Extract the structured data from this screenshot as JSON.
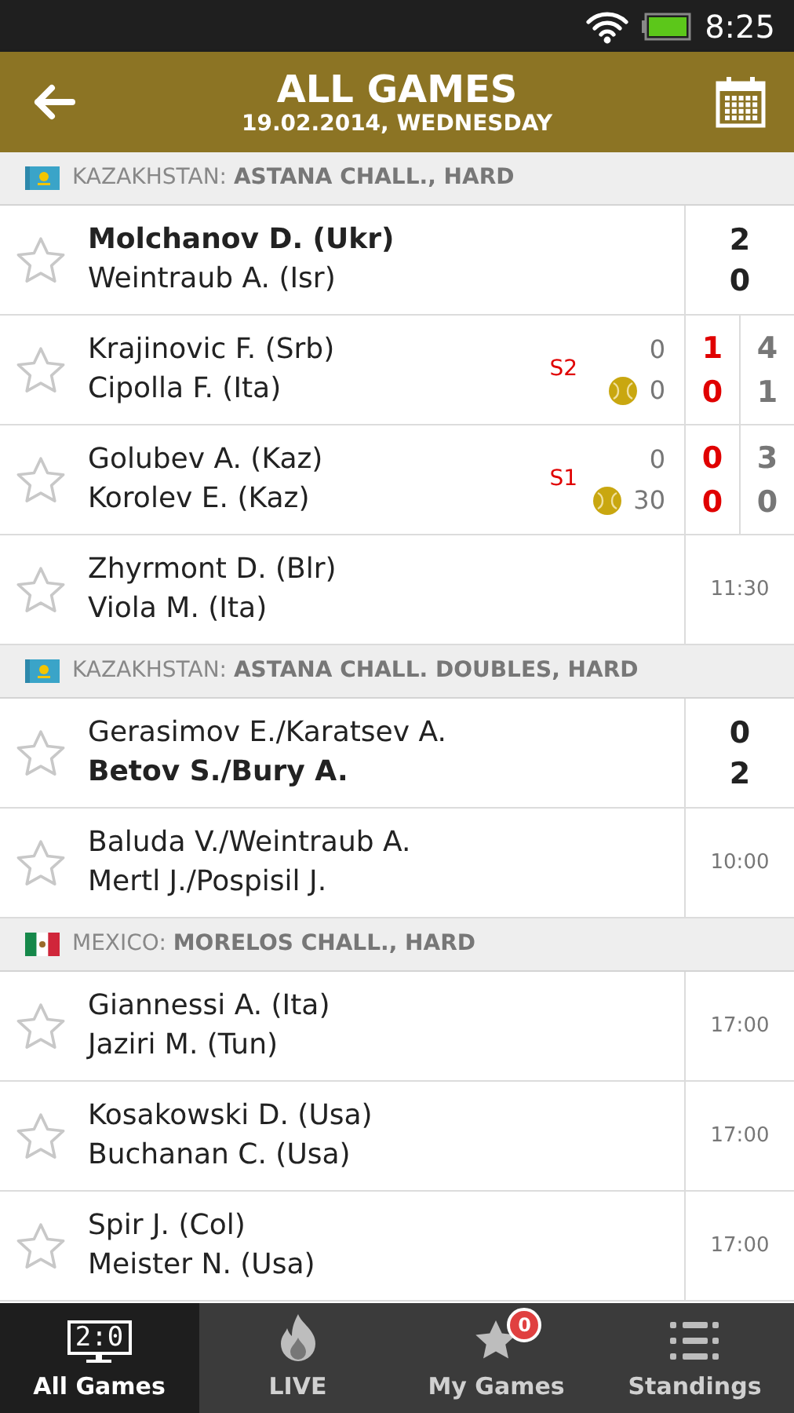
{
  "status_bar": {
    "time": "8:25"
  },
  "header": {
    "title": "ALL GAMES",
    "subtitle": "19.02.2014, WEDNESDAY"
  },
  "sections": [
    {
      "flag": {
        "kind": "kazakhstan"
      },
      "country": "KAZAKHSTAN:",
      "tournament": "ASTANA CHALL., HARD",
      "matches": [
        {
          "kind": "final",
          "starred": false,
          "players": [
            {
              "name": "Molchanov D. (Ukr)",
              "winner": true,
              "score": "2"
            },
            {
              "name": "Weintraub A. (Isr)",
              "winner": false,
              "score": "0"
            }
          ]
        },
        {
          "kind": "live",
          "starred": false,
          "set_label": "S2",
          "players": [
            {
              "name": "Krajinovic F. (Srb)",
              "serving": false,
              "points": "0",
              "current": "1",
              "previous": "4"
            },
            {
              "name": "Cipolla F. (Ita)",
              "serving": true,
              "points": "0",
              "current": "0",
              "previous": "1"
            }
          ]
        },
        {
          "kind": "live",
          "starred": false,
          "set_label": "S1",
          "players": [
            {
              "name": "Golubev A. (Kaz)",
              "serving": false,
              "points": "0",
              "current": "0",
              "previous": "3"
            },
            {
              "name": "Korolev E. (Kaz)",
              "serving": true,
              "points": "30",
              "current": "0",
              "previous": "0"
            }
          ]
        },
        {
          "kind": "scheduled",
          "starred": false,
          "time": "11:30",
          "players": [
            {
              "name": "Zhyrmont D. (Blr)"
            },
            {
              "name": "Viola M. (Ita)"
            }
          ]
        }
      ]
    },
    {
      "flag": {
        "kind": "kazakhstan"
      },
      "country": "KAZAKHSTAN:",
      "tournament": "ASTANA CHALL. DOUBLES, HARD",
      "matches": [
        {
          "kind": "final",
          "starred": false,
          "players": [
            {
              "name": "Gerasimov E./Karatsev A.",
              "winner": false,
              "score": "0"
            },
            {
              "name": "Betov S./Bury A.",
              "winner": true,
              "score": "2"
            }
          ]
        },
        {
          "kind": "scheduled",
          "starred": false,
          "time": "10:00",
          "players": [
            {
              "name": "Baluda V./Weintraub A."
            },
            {
              "name": "Mertl J./Pospisil J."
            }
          ]
        }
      ]
    },
    {
      "flag": {
        "kind": "mexico"
      },
      "country": "MEXICO:",
      "tournament": "MORELOS CHALL., HARD",
      "matches": [
        {
          "kind": "scheduled",
          "starred": false,
          "time": "17:00",
          "players": [
            {
              "name": "Giannessi A. (Ita)"
            },
            {
              "name": "Jaziri M. (Tun)"
            }
          ]
        },
        {
          "kind": "scheduled",
          "starred": false,
          "time": "17:00",
          "players": [
            {
              "name": "Kosakowski D. (Usa)"
            },
            {
              "name": "Buchanan C. (Usa)"
            }
          ]
        },
        {
          "kind": "scheduled",
          "starred": false,
          "time": "17:00",
          "players": [
            {
              "name": "Spir J. (Col)"
            },
            {
              "name": "Meister N. (Usa)"
            }
          ]
        }
      ]
    }
  ],
  "tabs": [
    {
      "kind": "scoreboard",
      "label": "All Games",
      "icon_text": "2:0",
      "selected": true
    },
    {
      "kind": "fire",
      "label": "LIVE",
      "selected": false
    },
    {
      "kind": "star",
      "label": "My Games",
      "badge": "0",
      "selected": false
    },
    {
      "kind": "standings",
      "label": "Standings",
      "selected": false
    }
  ]
}
